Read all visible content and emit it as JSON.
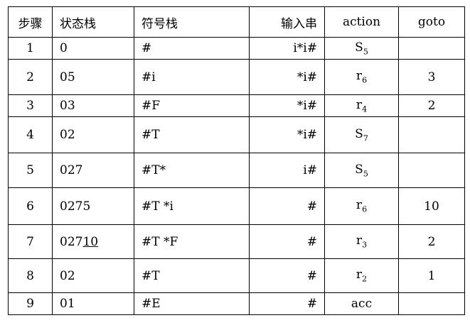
{
  "headers": {
    "step": "步骤",
    "state_stack": "状态栈",
    "symbol_stack": "符号栈",
    "input": "输入串",
    "action": "action",
    "goto": "goto"
  },
  "rows": [
    {
      "step": "1",
      "state": "0",
      "state_underlined": "",
      "symbol": "#",
      "input": "i*i#",
      "action_base": "S",
      "action_sub": "5",
      "goto": ""
    },
    {
      "step": "2",
      "state": "05",
      "state_underlined": "",
      "symbol": "#i",
      "input": "*i#",
      "action_base": "r",
      "action_sub": "6",
      "goto": "3"
    },
    {
      "step": "3",
      "state": "03",
      "state_underlined": "",
      "symbol": "#F",
      "input": "*i#",
      "action_base": "r",
      "action_sub": "4",
      "goto": "2"
    },
    {
      "step": "4",
      "state": "02",
      "state_underlined": "",
      "symbol": "#T",
      "input": "*i#",
      "action_base": "S",
      "action_sub": "7",
      "goto": ""
    },
    {
      "step": "5",
      "state": "027",
      "state_underlined": "",
      "symbol": "#T*",
      "input": "i#",
      "action_base": "S",
      "action_sub": "5",
      "goto": ""
    },
    {
      "step": "6",
      "state": "0275",
      "state_underlined": "",
      "symbol": "#T *i",
      "input": "#",
      "action_base": "r",
      "action_sub": "6",
      "goto": "10"
    },
    {
      "step": "7",
      "state": "027",
      "state_underlined": "10",
      "symbol": "#T *F",
      "input": "#",
      "action_base": "r",
      "action_sub": "3",
      "goto": "2"
    },
    {
      "step": "8",
      "state": "02",
      "state_underlined": "",
      "symbol": "#T",
      "input": "#",
      "action_base": "r",
      "action_sub": "2",
      "goto": "1"
    },
    {
      "step": "9",
      "state": "01",
      "state_underlined": "",
      "symbol": "#E",
      "input": "#",
      "action_base": "acc",
      "action_sub": "",
      "goto": ""
    }
  ]
}
